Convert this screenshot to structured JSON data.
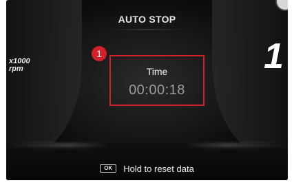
{
  "screen": {
    "title": "AUTO STOP",
    "rpm_unit": [
      "x1000",
      "rpm"
    ],
    "gear": "1"
  },
  "time_panel": {
    "label": "Time",
    "value": "00:00:18",
    "callout_number": "1",
    "callout_color": "#d3202a"
  },
  "footer": {
    "key_label": "OK",
    "hint": "Hold to reset data"
  }
}
